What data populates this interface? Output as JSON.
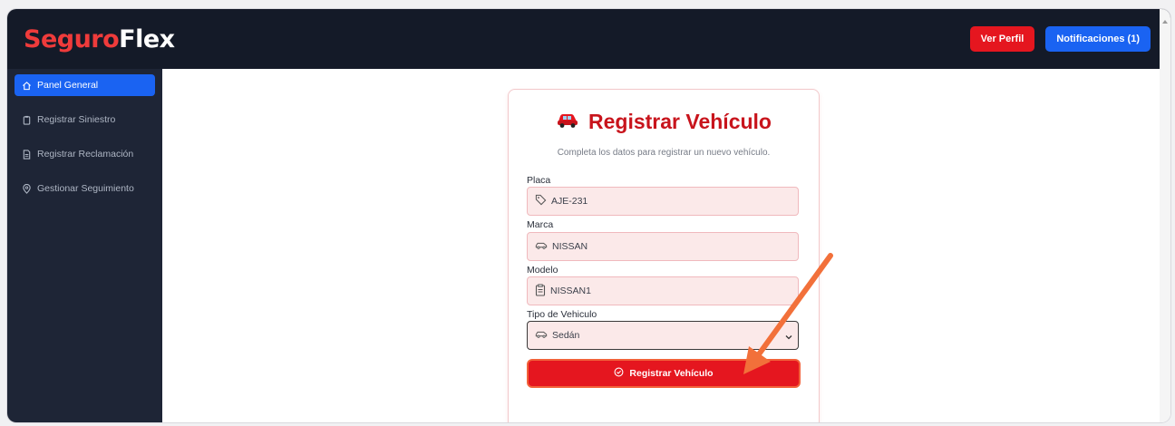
{
  "header": {
    "brand_part1": "Seguro",
    "brand_part2": "Flex",
    "profile_button": "Ver Perfil",
    "notifications_button": "Notificaciones (1)"
  },
  "sidebar": {
    "items": [
      {
        "label": "Panel General",
        "icon": "home-icon",
        "active": true
      },
      {
        "label": "Registrar Siniestro",
        "icon": "clipboard-icon",
        "active": false
      },
      {
        "label": "Registrar Reclamación",
        "icon": "document-icon",
        "active": false
      },
      {
        "label": "Gestionar Seguimiento",
        "icon": "location-pin-icon",
        "active": false
      }
    ]
  },
  "form": {
    "title": "Registrar Vehículo",
    "title_icon": "car-emoji",
    "subtitle": "Completa los datos para registrar un nuevo vehículo.",
    "fields": [
      {
        "label": "Placa",
        "value": "AJE-231",
        "icon": "tag-icon"
      },
      {
        "label": "Marca",
        "value": "NISSAN",
        "icon": "car-icon"
      },
      {
        "label": "Modelo",
        "value": "NISSAN1",
        "icon": "clipboard-icon"
      },
      {
        "label": "Tipo de Vehiculo",
        "value": "Sedán",
        "icon": "car-icon"
      }
    ],
    "submit_label": "Registrar Vehículo",
    "submit_icon": "check-circle-icon"
  },
  "colors": {
    "topbar": "#141a28",
    "sidebar": "#1e2536",
    "accent_red": "#e5161f",
    "accent_blue": "#1a63f2",
    "annotation_arrow": "#f2703a"
  }
}
